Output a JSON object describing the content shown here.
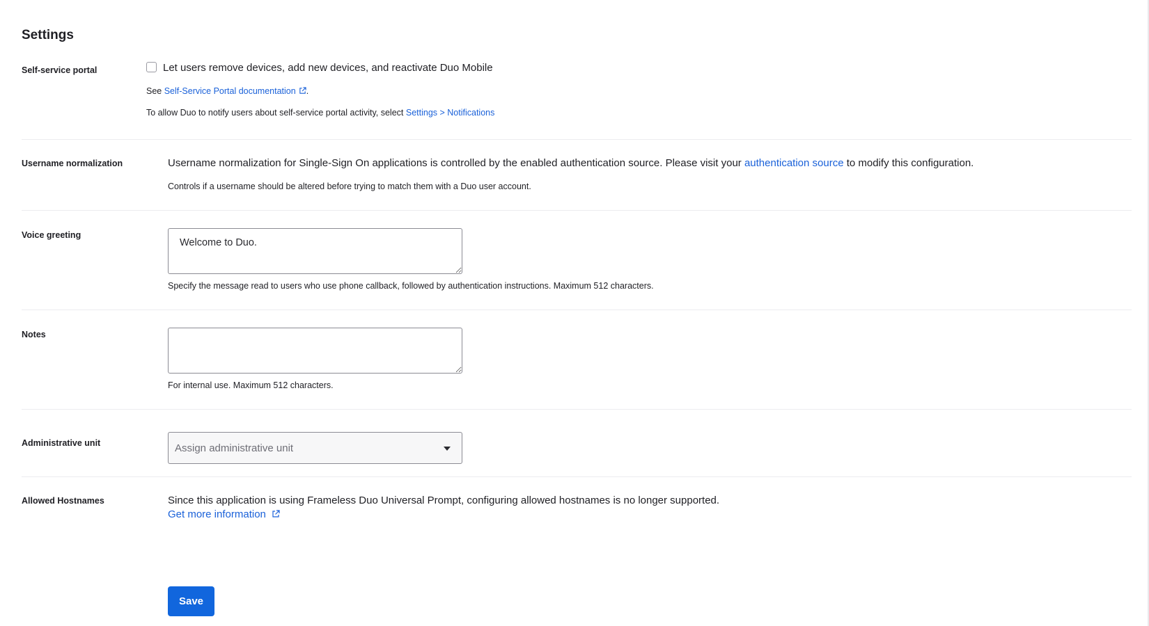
{
  "page": {
    "title": "Settings"
  },
  "self_service": {
    "label": "Self-service portal",
    "checkbox_label": "Let users remove devices, add new devices, and reactivate Duo Mobile",
    "doc_prefix": "See ",
    "doc_link": "Self-Service Portal documentation",
    "doc_suffix": ".",
    "notify_text": "To allow Duo to notify users about self-service portal activity, select ",
    "notify_link": "Settings > Notifications"
  },
  "username_normalization": {
    "label": "Username normalization",
    "text_before": "Username normalization for Single-Sign On applications is controlled by the enabled authentication source. Please visit your ",
    "link": "authentication source",
    "text_after": " to modify this configuration.",
    "help": "Controls if a username should be altered before trying to match them with a Duo user account."
  },
  "voice_greeting": {
    "label": "Voice greeting",
    "value": "Welcome to Duo.",
    "help": "Specify the message read to users who use phone callback, followed by authentication instructions. Maximum 512 characters."
  },
  "notes": {
    "label": "Notes",
    "value": "",
    "help": "For internal use. Maximum 512 characters."
  },
  "administrative_unit": {
    "label": "Administrative unit",
    "placeholder": "Assign administrative unit"
  },
  "allowed_hostnames": {
    "label": "Allowed Hostnames",
    "text": "Since this application is using Frameless Duo Universal Prompt, configuring allowed hostnames is no longer supported.",
    "link": "Get more information"
  },
  "actions": {
    "save_label": "Save"
  },
  "colors": {
    "link": "#1a61d9",
    "primary_button": "#1166dd"
  },
  "icons": {
    "external_link": "external-link-icon",
    "dropdown": "chevron-down-icon"
  }
}
